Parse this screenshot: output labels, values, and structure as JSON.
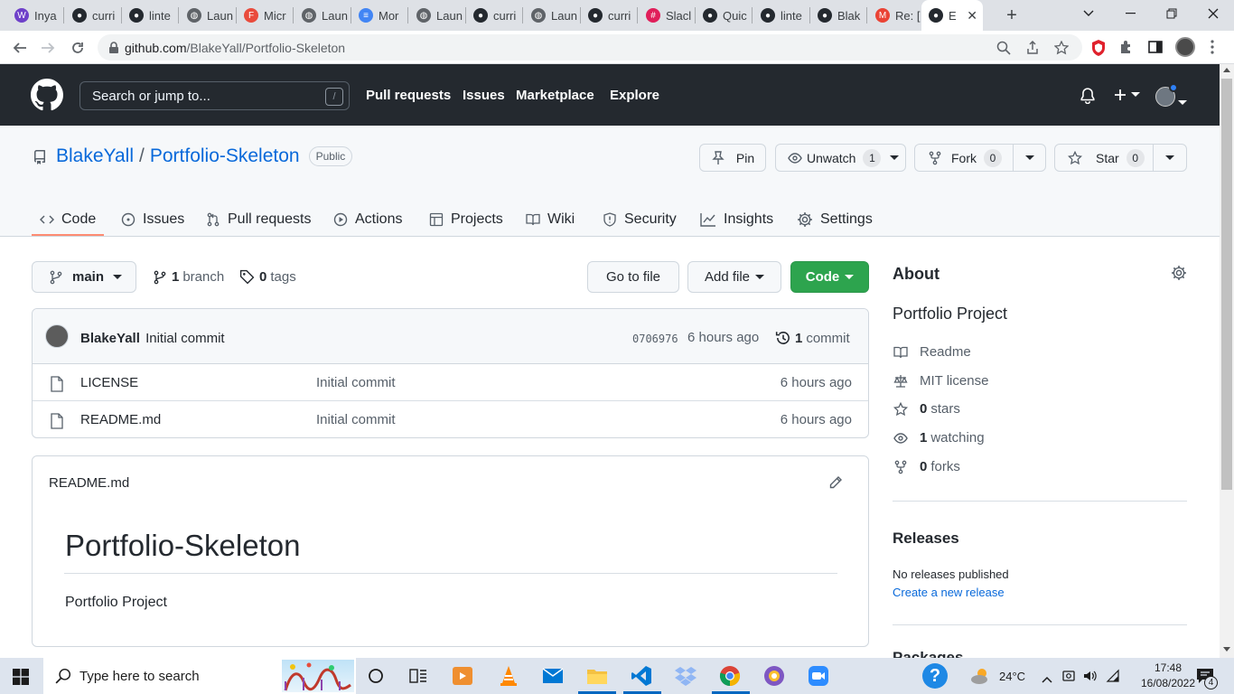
{
  "browser": {
    "tabs": [
      {
        "label": "Inya",
        "color": "#6e40c9",
        "glyph": "W"
      },
      {
        "label": "curri",
        "color": "#24292f",
        "glyph": "●"
      },
      {
        "label": "linte",
        "color": "#24292f",
        "glyph": "●"
      },
      {
        "label": "Laun",
        "color": "#5f6368",
        "glyph": "◍"
      },
      {
        "label": "Micr",
        "color": "#e94b3c",
        "glyph": "F"
      },
      {
        "label": "Laun",
        "color": "#5f6368",
        "glyph": "◍"
      },
      {
        "label": "Mor",
        "color": "#4285f4",
        "glyph": "≡"
      },
      {
        "label": "Laun",
        "color": "#5f6368",
        "glyph": "◍"
      },
      {
        "label": "curri",
        "color": "#24292f",
        "glyph": "●"
      },
      {
        "label": "Laun",
        "color": "#5f6368",
        "glyph": "◍"
      },
      {
        "label": "curri",
        "color": "#24292f",
        "glyph": "●"
      },
      {
        "label": "Slacl",
        "color": "#e01e5a",
        "glyph": "#"
      },
      {
        "label": "Quic",
        "color": "#24292f",
        "glyph": "●"
      },
      {
        "label": "linte",
        "color": "#24292f",
        "glyph": "●"
      },
      {
        "label": "Blak",
        "color": "#24292f",
        "glyph": "●"
      },
      {
        "label": "Re: [",
        "color": "#ea4335",
        "glyph": "M"
      },
      {
        "label": "E",
        "color": "#24292f",
        "glyph": "●"
      }
    ],
    "new_tab": "+",
    "url_host": "github.com",
    "url_path": "/BlakeYall/Portfolio-Skeleton"
  },
  "header": {
    "search_placeholder": "Search or jump to...",
    "search_key": "/",
    "nav": [
      "Pull requests",
      "Issues",
      "Marketplace",
      "Explore"
    ]
  },
  "repo": {
    "owner": "BlakeYall",
    "separator": "/",
    "name": "Portfolio-Skeleton",
    "visibility": "Public",
    "pin_label": "Pin",
    "unwatch_label": "Unwatch",
    "unwatch_count": "1",
    "fork_label": "Fork",
    "fork_count": "0",
    "star_label": "Star",
    "star_count": "0",
    "tabs": [
      "Code",
      "Issues",
      "Pull requests",
      "Actions",
      "Projects",
      "Wiki",
      "Security",
      "Insights",
      "Settings"
    ]
  },
  "toolbar": {
    "branch": "main",
    "branch_count": "1",
    "branch_word": "branch",
    "tag_count": "0",
    "tag_word": "tags",
    "go_to_file": "Go to file",
    "add_file": "Add file",
    "code": "Code"
  },
  "commit": {
    "author": "BlakeYall",
    "message": "Initial commit",
    "sha": "0706976",
    "time": "6 hours ago",
    "count": "1",
    "count_word": "commit"
  },
  "files": [
    {
      "name": "LICENSE",
      "message": "Initial commit",
      "time": "6 hours ago"
    },
    {
      "name": "README.md",
      "message": "Initial commit",
      "time": "6 hours ago"
    }
  ],
  "readme": {
    "filename": "README.md",
    "heading": "Portfolio-Skeleton",
    "body": "Portfolio Project"
  },
  "about": {
    "title": "About",
    "description": "Portfolio Project",
    "readme": "Readme",
    "license": "MIT license",
    "stars_count": "0",
    "stars_word": "stars",
    "watching_count": "1",
    "watching_word": "watching",
    "forks_count": "0",
    "forks_word": "forks"
  },
  "releases": {
    "title": "Releases",
    "none": "No releases published",
    "create": "Create a new release",
    "next_heading_partial": "Packages"
  },
  "taskbar": {
    "search_placeholder": "Type here to search",
    "temperature": "24°C",
    "time": "17:48",
    "date": "16/08/2022",
    "notification_count": "4"
  }
}
